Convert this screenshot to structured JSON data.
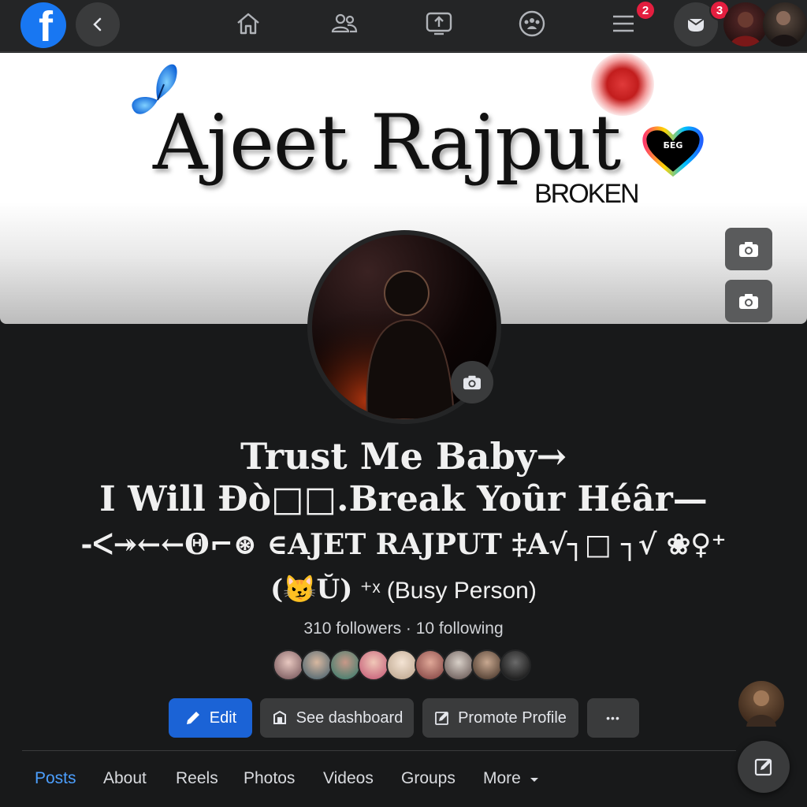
{
  "nav": {
    "menu_badge": "2",
    "messenger_badge": "3"
  },
  "cover": {
    "name": "Ajeet Rajput",
    "subtitle": "BROKEN",
    "heart_text": "БЕG"
  },
  "profile": {
    "title_line1": "Trust Me Baby→",
    "title_line2": "I Will Ðò□□.Break Yoȗr Héȃr—",
    "title_line3": "-ᐸ↠←←Θ⌐⊛ ∈AJET RAJPUT ‡A√┐□ ┐√ ❀♀⁺",
    "title_line4_symbol": "(😼Ŭ)",
    "title_line4_suffix": "⁺ˣ (Busy Person)",
    "followers": "310 followers · 10 following"
  },
  "actions": {
    "edit": "Edit",
    "dashboard": "See dashboard",
    "promote": "Promote Profile",
    "more": "•••"
  },
  "tabs": [
    "Posts",
    "About",
    "Reels",
    "Photos",
    "Videos",
    "Groups",
    "More"
  ],
  "colors": {
    "accent": "#1b63d6",
    "active_tab": "#4c9ffe",
    "badge": "#e41e3f"
  }
}
